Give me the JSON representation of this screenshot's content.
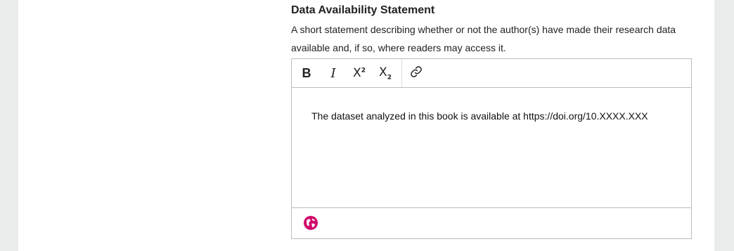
{
  "field": {
    "label": "Data Availability Statement",
    "description": "A short statement describing whether or not the author(s) have made their research data available and, if so, where readers may access it."
  },
  "toolbar": {
    "bold_label": "B",
    "italic_label": "I",
    "superscript_base": "X",
    "superscript_mark": "2",
    "subscript_base": "X",
    "subscript_mark": "2",
    "link_icon": "link-icon"
  },
  "editor": {
    "content": "The dataset analyzed in this book is available at https://doi.org/10.XXXX.XXX"
  },
  "footer": {
    "language_icon": "globe-icon",
    "accent_color": "#d00a6c"
  }
}
